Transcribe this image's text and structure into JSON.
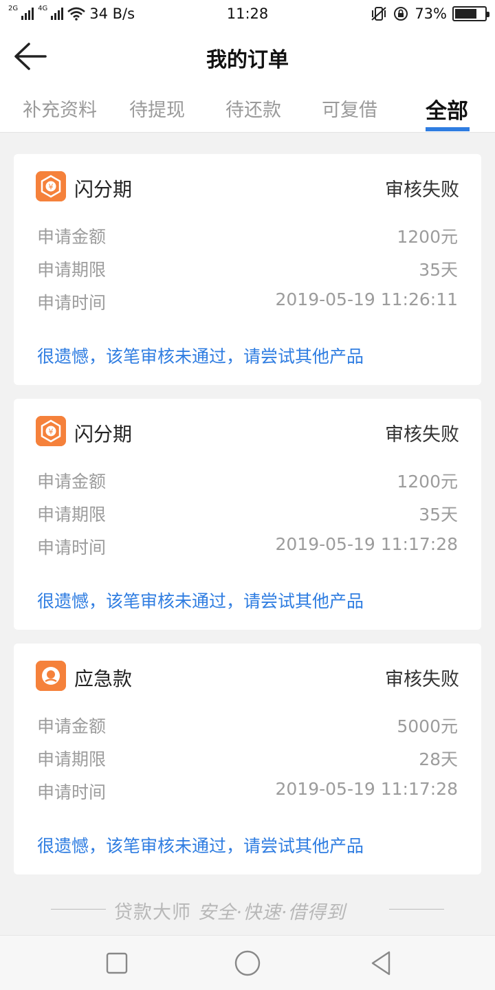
{
  "status_bar": {
    "net_tag_1": "2G",
    "net_tag_2": "4G",
    "speed": "34 B/s",
    "time": "11:28",
    "battery_text": "73%",
    "battery_level": 0.73
  },
  "header": {
    "title": "我的订单"
  },
  "tabs": [
    {
      "label": "补充资料"
    },
    {
      "label": "待提现"
    },
    {
      "label": "待还款"
    },
    {
      "label": "可复借"
    },
    {
      "label": "全部"
    }
  ],
  "active_tab": "全部",
  "accent_color": "#2f7de1",
  "logo_color": "#f5813b",
  "orders": [
    {
      "name": "闪分期",
      "icon": "shanfenqi-logo-icon",
      "status": "审核失败",
      "amount_label": "申请金额",
      "amount": "1200元",
      "term_label": "申请期限",
      "term": "35天",
      "time_label": "申请时间",
      "time": "2019-05-19 11:26:11",
      "note": "很遗憾，该笔审核未通过，请尝试其他产品"
    },
    {
      "name": "闪分期",
      "icon": "shanfenqi-logo-icon",
      "status": "审核失败",
      "amount_label": "申请金额",
      "amount": "1200元",
      "term_label": "申请期限",
      "term": "35天",
      "time_label": "申请时间",
      "time": "2019-05-19 11:17:28",
      "note": "很遗憾，该笔审核未通过，请尝试其他产品"
    },
    {
      "name": "应急款",
      "icon": "yingjikuan-logo-icon",
      "status": "审核失败",
      "amount_label": "申请金额",
      "amount": "5000元",
      "term_label": "申请期限",
      "term": "28天",
      "time_label": "申请时间",
      "time": "2019-05-19 11:17:28",
      "note": "很遗憾，该笔审核未通过，请尝试其他产品"
    }
  ],
  "footer": {
    "brand": "贷款大师",
    "tagline": "安全·快速·借得到"
  }
}
